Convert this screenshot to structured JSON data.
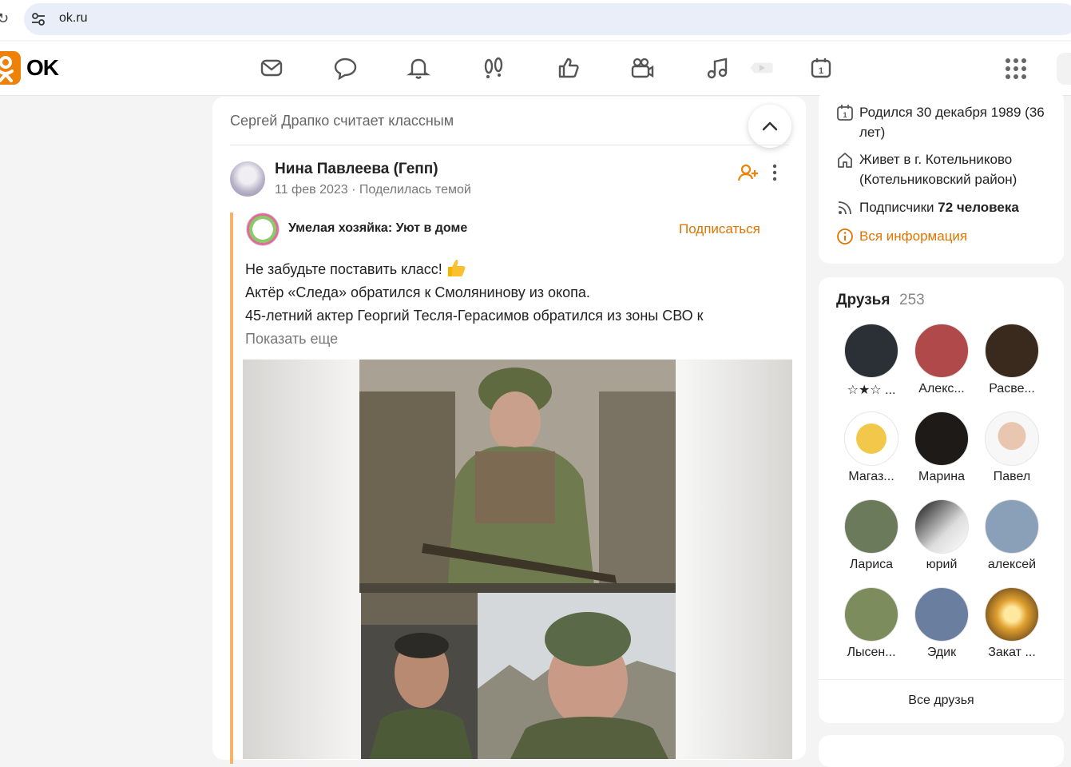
{
  "browser": {
    "url": "ok.ru"
  },
  "header": {
    "logo_text": "OK",
    "nav_icons": [
      "messages-icon",
      "discussions-icon",
      "notifications-icon",
      "guests-icon",
      "events-likes-icon",
      "video-icon",
      "music-icon",
      "play-icon",
      "calendar-icon"
    ],
    "accent": "#ee8208"
  },
  "feed": {
    "likes_line": "Сергей Драпко считает классным",
    "post": {
      "author": "Нина Павлеева (Гепп)",
      "date": "11 фев 2023",
      "action": "Поделилась темой",
      "group_name": "Умелая хозяйка: Уют в доме",
      "subscribe_label": "Подписаться",
      "text_lines": [
        "Не забудьте поставить класс!",
        "Актёр «Следа» обратился к Смолянинову из окопа.",
        "45-летний актер Георгий Тесля-Герасимов обратился из зоны СВО к"
      ],
      "show_more": "Показать еще"
    }
  },
  "sidebar": {
    "info": {
      "born": "Родился 30 декабря 1989 (36 лет)",
      "lives": "Живет в г. Котельниково (Котельниковский район)",
      "subscribers_label": "Подписчики",
      "subscribers_count": "72 человека",
      "all_info": "Вся информация"
    },
    "friends": {
      "title": "Друзья",
      "count": "253",
      "items": [
        {
          "name": "☆★☆ ...",
          "color": "#2b2f36"
        },
        {
          "name": "Алекс...",
          "color": "#b04a4a"
        },
        {
          "name": "Расве...",
          "color": "#3a2a1e"
        },
        {
          "name": "Магаз...",
          "color": "#f2c84b"
        },
        {
          "name": "Марина",
          "color": "#1e1a18"
        },
        {
          "name": "Павел",
          "color": "#e8c6b0"
        },
        {
          "name": "Лариса",
          "color": "#6b7a5a"
        },
        {
          "name": "юрий",
          "color": "#c9c9c9"
        },
        {
          "name": "алексей",
          "color": "#8aa0b8"
        },
        {
          "name": "Лысен...",
          "color": "#7c8c5c"
        },
        {
          "name": "Эдик",
          "color": "#6a7ea0"
        },
        {
          "name": "Закат ...",
          "color": "#e0a030"
        }
      ],
      "all_label": "Все друзья"
    }
  }
}
